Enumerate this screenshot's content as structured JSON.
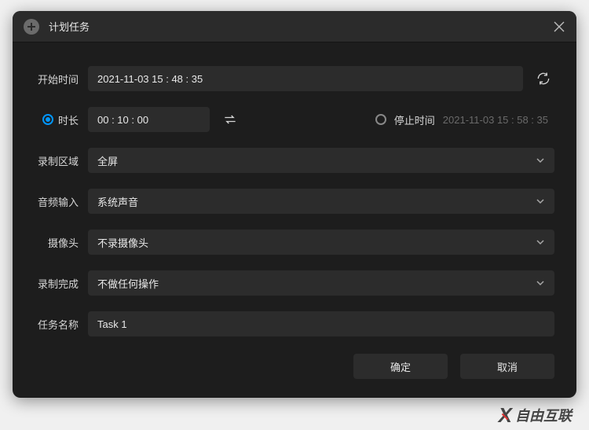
{
  "header": {
    "title": "计划任务"
  },
  "form": {
    "start_time": {
      "label": "开始时间",
      "value": "2021-11-03 15 : 48 : 35"
    },
    "duration": {
      "label": "时长",
      "value": "00 : 10 : 00"
    },
    "stop_time": {
      "label": "停止时间",
      "value": "2021-11-03 15 : 58 : 35"
    },
    "region": {
      "label": "录制区域",
      "value": "全屏"
    },
    "audio": {
      "label": "音频输入",
      "value": "系统声音"
    },
    "camera": {
      "label": "摄像头",
      "value": "不录摄像头"
    },
    "after": {
      "label": "录制完成",
      "value": "不做任何操作"
    },
    "task_name": {
      "label": "任务名称",
      "value": "Task 1"
    }
  },
  "buttons": {
    "ok": "确定",
    "cancel": "取消"
  },
  "watermark": "自由互联"
}
